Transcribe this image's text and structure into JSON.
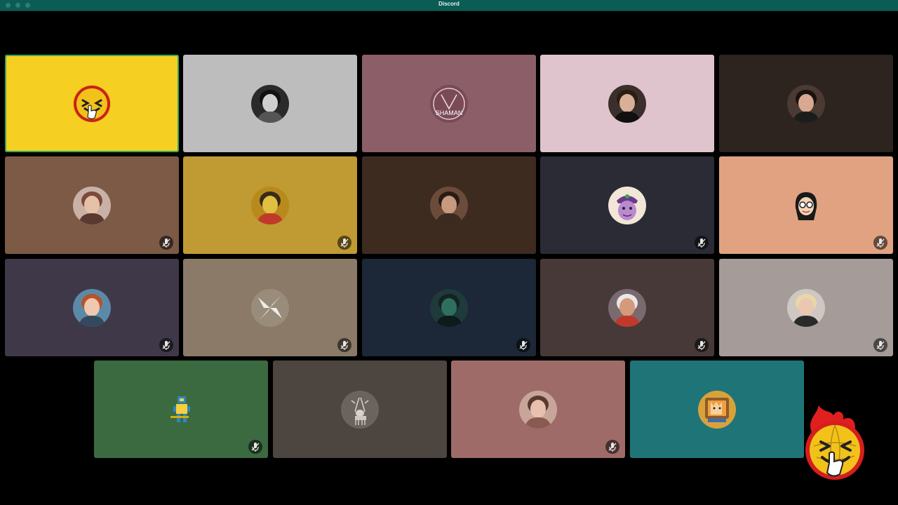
{
  "window": {
    "title": "Discord"
  },
  "colors": {
    "titlebar": "#0b5c54",
    "speaking_ring": "#3ba55c"
  },
  "participants": [
    {
      "tile_color": "#f5d022",
      "speaking": true,
      "muted": false,
      "avatar": "yellow-grin-emoji-icon"
    },
    {
      "tile_color": "#bdbdbd",
      "speaking": false,
      "muted": false,
      "avatar": "bw-photo-avatar"
    },
    {
      "tile_color": "#8b5e68",
      "speaking": false,
      "muted": false,
      "avatar": "shaman-logo-avatar",
      "avatar_text": "SHAMAN"
    },
    {
      "tile_color": "#e0c4cd",
      "speaking": false,
      "muted": false,
      "avatar": "man-photo-avatar"
    },
    {
      "tile_color": "#2d241f",
      "speaking": false,
      "muted": false,
      "avatar": "woman-photo-avatar"
    },
    {
      "tile_color": "#7d5a46",
      "speaking": false,
      "muted": true,
      "avatar": "couple-photo-avatar"
    },
    {
      "tile_color": "#c09a32",
      "speaking": false,
      "muted": true,
      "avatar": "yellow-scene-avatar"
    },
    {
      "tile_color": "#3e2b20",
      "speaking": false,
      "muted": false,
      "avatar": "headphones-man-avatar"
    },
    {
      "tile_color": "#2b2b36",
      "speaking": false,
      "muted": true,
      "avatar": "cartoon-face-avatar"
    },
    {
      "tile_color": "#e0a281",
      "speaking": false,
      "muted": true,
      "avatar": "cartoon-girl-avatar"
    },
    {
      "tile_color": "#3e3849",
      "speaking": false,
      "muted": true,
      "avatar": "glasses-man-avatar"
    },
    {
      "tile_color": "#8a7a67",
      "speaking": false,
      "muted": true,
      "avatar": "white-shape-avatar"
    },
    {
      "tile_color": "#1c2737",
      "speaking": false,
      "muted": true,
      "avatar": "dark-portrait-avatar"
    },
    {
      "tile_color": "#463938",
      "speaking": false,
      "muted": true,
      "avatar": "chef-photo-avatar"
    },
    {
      "tile_color": "#a59b98",
      "speaking": false,
      "muted": true,
      "avatar": "blonde-person-avatar"
    },
    {
      "tile_color": "#3b6a41",
      "speaking": false,
      "muted": true,
      "avatar": "pixel-robot-avatar"
    },
    {
      "tile_color": "#4c4540",
      "speaking": false,
      "muted": false,
      "avatar": "deer-avatar"
    },
    {
      "tile_color": "#9e6b69",
      "speaking": false,
      "muted": true,
      "avatar": "smiling-person-avatar"
    },
    {
      "tile_color": "#1f7478",
      "speaking": false,
      "muted": false,
      "avatar": "cat-tv-avatar"
    }
  ],
  "self_view": {
    "avatar": "flaming-grin-emoji-icon"
  }
}
